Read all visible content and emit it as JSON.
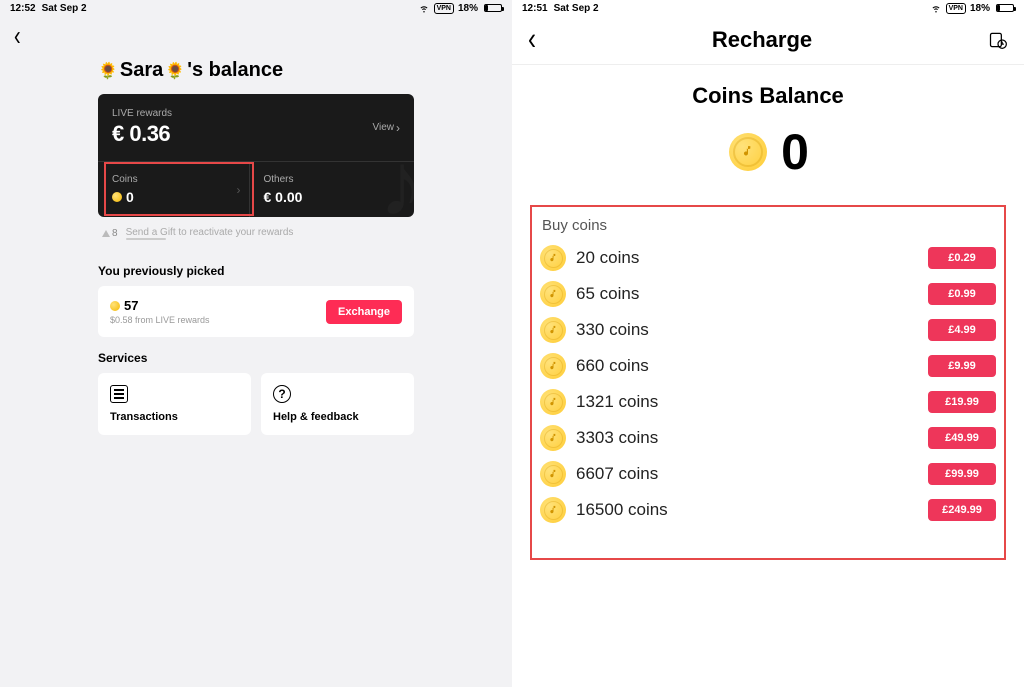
{
  "left": {
    "status": {
      "time": "12:52",
      "date": "Sat Sep 2",
      "vpn": "VPN",
      "battery": "18%"
    },
    "title_prefix": "Sara",
    "title_suffix": "'s balance",
    "live_card": {
      "rewards_label": "LIVE rewards",
      "rewards_amount": "€ 0.36",
      "view": "View",
      "coins_label": "Coins",
      "coins_value": "0",
      "others_label": "Others",
      "others_value": "€ 0.00"
    },
    "hint": {
      "count": "8",
      "text": "Send a Gift to reactivate your rewards"
    },
    "previously": {
      "heading": "You previously picked",
      "amount": "57",
      "sub": "$0.58 from LIVE rewards",
      "button": "Exchange"
    },
    "services": {
      "heading": "Services",
      "transactions": "Transactions",
      "help": "Help & feedback"
    }
  },
  "right": {
    "status": {
      "time": "12:51",
      "date": "Sat Sep 2",
      "vpn": "VPN",
      "battery": "18%"
    },
    "header_title": "Recharge",
    "balance_title": "Coins Balance",
    "balance_value": "0",
    "buy_title": "Buy coins",
    "packages": [
      {
        "label": "20 coins",
        "price": "£0.29"
      },
      {
        "label": "65 coins",
        "price": "£0.99"
      },
      {
        "label": "330 coins",
        "price": "£4.99"
      },
      {
        "label": "660 coins",
        "price": "£9.99"
      },
      {
        "label": "1321 coins",
        "price": "£19.99"
      },
      {
        "label": "3303 coins",
        "price": "£49.99"
      },
      {
        "label": "6607 coins",
        "price": "£99.99"
      },
      {
        "label": "16500 coins",
        "price": "£249.99"
      }
    ]
  }
}
